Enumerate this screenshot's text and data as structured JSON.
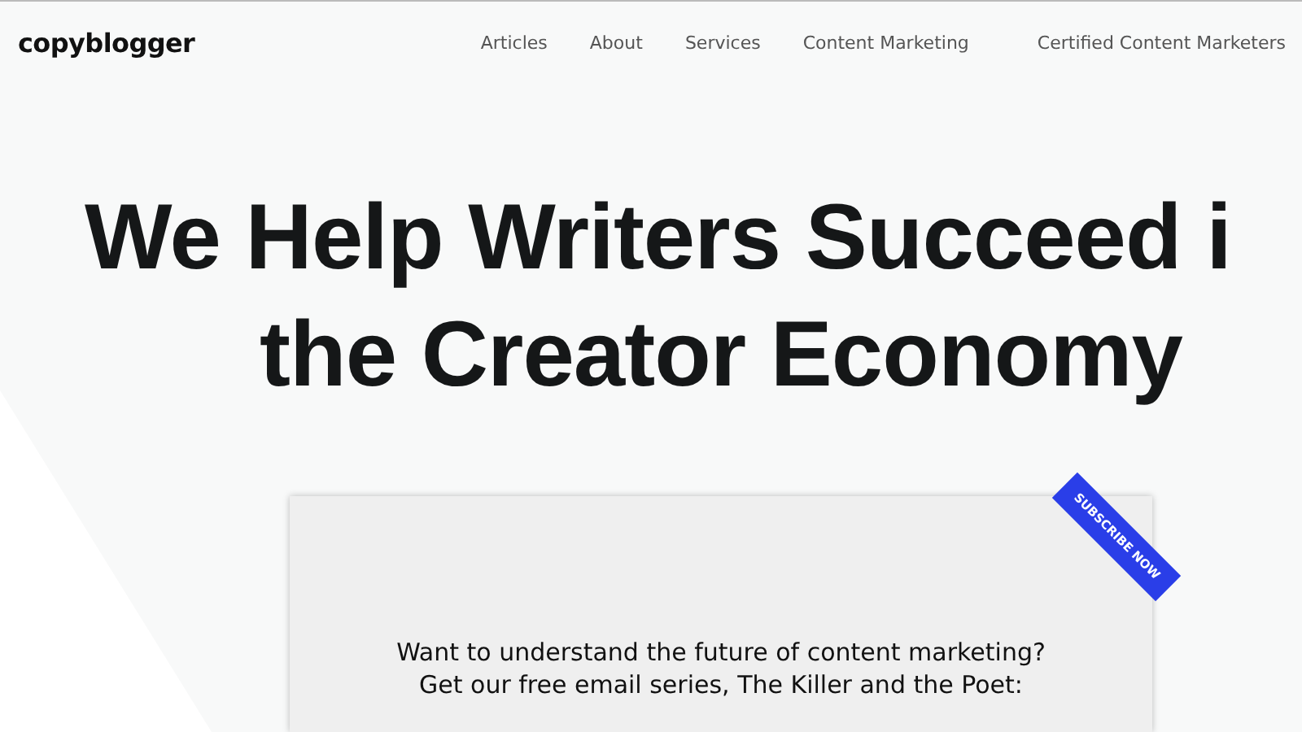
{
  "header": {
    "logo": "copyblogger",
    "nav": [
      {
        "label": "Articles"
      },
      {
        "label": "About"
      },
      {
        "label": "Services"
      },
      {
        "label": "Content Marketing"
      },
      {
        "label": "Certified Content Marketers"
      }
    ]
  },
  "hero": {
    "headline_lines": [
      "We Help Writers Succeed i",
      "the Creator Economy"
    ]
  },
  "signup_card": {
    "ribbon": "SUBSCRIBE NOW",
    "text_lines": [
      "Want to understand the future of content marketing?",
      "Get our free email series, The Killer and the Poet:"
    ]
  }
}
